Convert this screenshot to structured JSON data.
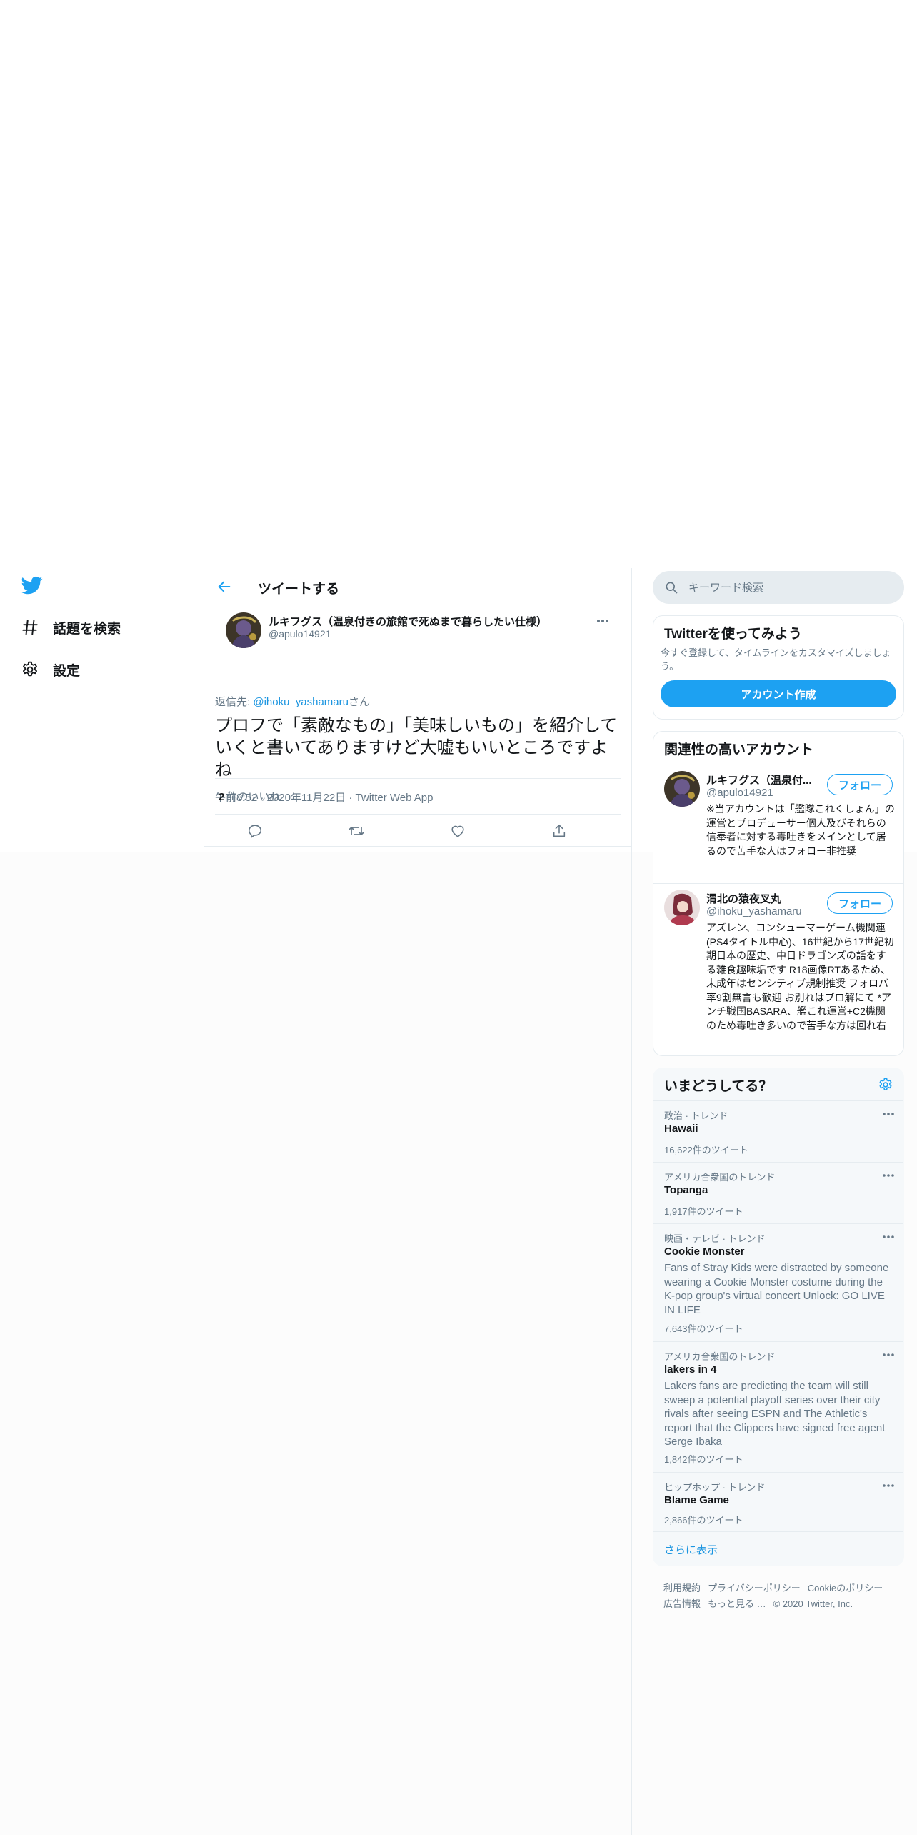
{
  "nav": {
    "explore_label": "話題を検索",
    "settings_label": "設定"
  },
  "header": {
    "title": "ツイートする"
  },
  "tweet": {
    "author_name": "ルキフグス（温泉付きの旅館で死ぬまで暮らしたい仕様）",
    "author_handle": "@apulo14921",
    "reply_prefix": "返信先: ",
    "reply_mention": "@ihoku_yashamaru",
    "reply_suffix": "さん",
    "text": "プロフで「素敵なもの」「美味しいもの」を紹介していくと書いてありますけど大嘘もいいところですよね",
    "time": "午前8:52",
    "date": "2020年11月22日",
    "source": "Twitter Web App",
    "separator": "·",
    "like_count": "2",
    "like_label": "件のいいね"
  },
  "search": {
    "placeholder": "キーワード検索"
  },
  "signup": {
    "title": "Twitterを使ってみよう",
    "description": "今すぐ登録して、タイムラインをカスタマイズしましょう。",
    "button_label": "アカウント作成"
  },
  "related": {
    "title": "関連性の高いアカウント",
    "follow_label": "フォロー",
    "accounts": [
      {
        "name": "ルキフグス（温泉付...",
        "handle": "@apulo14921",
        "bio": "※当アカウントは「艦隊これくしょん」の運営とプロデューサー個人及びそれらの信奉者に対する毒吐きをメインとして居るので苦手な人はフォロー非推奨"
      },
      {
        "name": "渭北の猿夜叉丸",
        "handle": "@ihoku_yashamaru",
        "bio": "アズレン、コンシューマーゲーム機関連(PS4タイトル中心)、16世紀から17世紀初期日本の歴史、中日ドラゴンズの話をする雑食趣味垢です R18画像RTあるため、未成年はセンシティブ規制推奨 フォロバ率9割無言も歓迎 お別れはブロ解にて *アンチ戦国BASARA、艦これ運営+C2機関のため毒吐き多いので苦手な方は回れ右"
      }
    ]
  },
  "trends": {
    "title": "いまどうしてる？",
    "items": [
      {
        "context": "政治 · トレンド",
        "name": "Hawaii",
        "description": "",
        "count": "16,622件のツイート"
      },
      {
        "context": "アメリカ合衆国のトレンド",
        "name": "Topanga",
        "description": "",
        "count": "1,917件のツイート"
      },
      {
        "context": "映画・テレビ · トレンド",
        "name": "Cookie Monster",
        "description": "Fans of Stray Kids were distracted by someone wearing a Cookie Monster costume during the K-pop group's virtual concert Unlock: GO LIVE IN LIFE",
        "count": "7,643件のツイート"
      },
      {
        "context": "アメリカ合衆国のトレンド",
        "name": "lakers in 4",
        "description": "Lakers fans are predicting the team will still sweep a potential playoff series over their city rivals after seeing ESPN and The Athletic's report that the Clippers have signed free agent Serge Ibaka",
        "count": "1,842件のツイート"
      },
      {
        "context": "ヒップホップ · トレンド",
        "name": "Blame Game",
        "description": "",
        "count": "2,866件のツイート"
      }
    ],
    "show_more": "さらに表示"
  },
  "footer": {
    "terms": "利用規約",
    "privacy": "プライバシーポリシー",
    "cookies": "Cookieのポリシー",
    "ads": "広告情報",
    "more": "もっと見る …",
    "copyright": "© 2020 Twitter, Inc."
  },
  "colors": {
    "accent": "#1da1f2",
    "link": "#1b95e0",
    "secondary_text": "#657786",
    "border": "#e6ecf0"
  },
  "icons": [
    "twitter-logo-icon",
    "hashtag-icon",
    "gear-icon",
    "back-arrow-icon",
    "more-icon",
    "reply-icon",
    "retweet-icon",
    "like-icon",
    "share-icon",
    "search-icon"
  ]
}
